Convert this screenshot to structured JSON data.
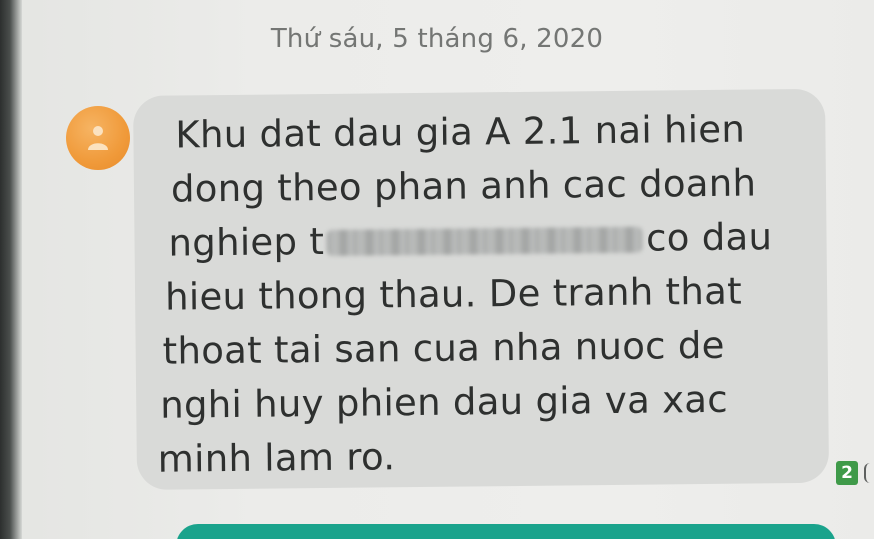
{
  "conversation": {
    "date_header": "Thứ sáu, 5 tháng 6, 2020",
    "message": {
      "sender_avatar_icon": "person-icon",
      "avatar_color": "#f09a3a",
      "bubble_color": "#d9dad8",
      "lines": [
        "Khu dat dau gia A 2.1 nai hien",
        "dong theo phan anh cac doanh",
        "nghiep t",
        "co dau",
        "hieu thong thau. De tranh that",
        "thoat tai san cua nha nuoc de",
        "nghi huy phien dau gia va xac",
        "minh lam ro."
      ],
      "sim_badge": "2",
      "sim_badge_color": "#3f9a49"
    },
    "next_message_color": "#1aa38c"
  }
}
